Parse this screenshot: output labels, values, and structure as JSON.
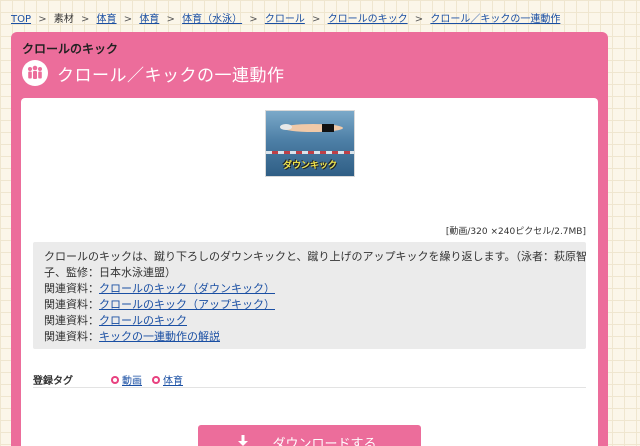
{
  "breadcrumb": {
    "items": [
      "TOP",
      "素材",
      "体育",
      "体育",
      "体育（水泳）",
      "クロール",
      "クロールのキック",
      "クロール／キックの一連動作"
    ]
  },
  "panel": {
    "category": "クロールのキック",
    "title": "クロール／キックの一連動作",
    "icon": "people-icon"
  },
  "media": {
    "caption": "ダウンキック",
    "meta": "[動画/320 ×240ピクセル/2.7MB]"
  },
  "description": {
    "text": "クロールのキックは、蹴り下ろしのダウンキックと、蹴り上げのアップキックを繰り返します。（泳者：萩原智",
    "text2": "子、監修：日本水泳連盟）",
    "related": [
      {
        "label": "関連資料：",
        "link": "クロールのキック（ダウンキック）"
      },
      {
        "label": "関連資料：",
        "link": "クロールのキック（アップキック）"
      },
      {
        "label": "関連資料：",
        "link": "クロールのキック"
      },
      {
        "label": "関連資料：",
        "link": "キックの一連動作の解説"
      }
    ]
  },
  "tags": {
    "label": "登録タグ",
    "items": [
      "動画",
      "体育"
    ]
  },
  "download": {
    "label": "ダウンロードする"
  },
  "colors": {
    "accent": "#ec6d9b",
    "link": "#1a4fa3",
    "tag_dot": "#e8417f"
  }
}
